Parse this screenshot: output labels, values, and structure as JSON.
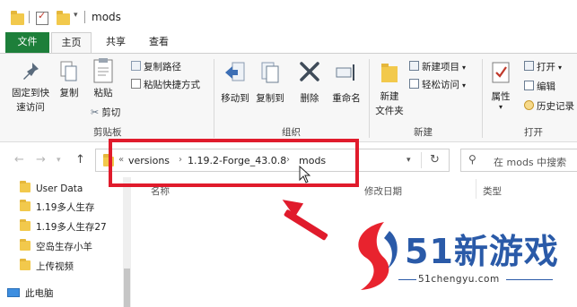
{
  "window": {
    "title": "mods"
  },
  "tabs": {
    "file": "文件",
    "home": "主页",
    "share": "共享",
    "view": "查看"
  },
  "ribbon": {
    "pin": "固定到快",
    "pin2": "速访问",
    "copy": "复制",
    "paste": "粘贴",
    "copy_path": "复制路径",
    "paste_shortcut": "粘贴快捷方式",
    "cut": "剪切",
    "clipboard_group": "剪贴板",
    "move_to": "移动到",
    "copy_to": "复制到",
    "delete": "删除",
    "rename": "重命名",
    "organize_group": "组织",
    "new_folder": "新建",
    "new_folder2": "文件夹",
    "new_item": "新建项目",
    "easy_access": "轻松访问",
    "new_group": "新建",
    "properties": "属性",
    "open": "打开",
    "edit": "编辑",
    "history": "历史记录",
    "open_group": "打开"
  },
  "address": {
    "prefix": "«",
    "crumbs": [
      "versions",
      "1.19.2-Forge_43.0.8",
      "mods"
    ],
    "search_placeholder": "在 mods 中搜索"
  },
  "list": {
    "col_name": "名称",
    "col_date": "修改日期",
    "col_type": "类型"
  },
  "nav_items": [
    "User Data",
    "1.19多人生存",
    "1.19多人生存27",
    "空岛生存小羊",
    "上传视频"
  ],
  "this_pc": "此电脑",
  "logo": {
    "big": "51新游戏",
    "url": "51chengyu.com"
  },
  "colors": {
    "file_tab": "#1d7f3a",
    "highlight": "#e01b2c",
    "folder": "#f2c94c",
    "logo_blue": "#2a5aa8"
  }
}
